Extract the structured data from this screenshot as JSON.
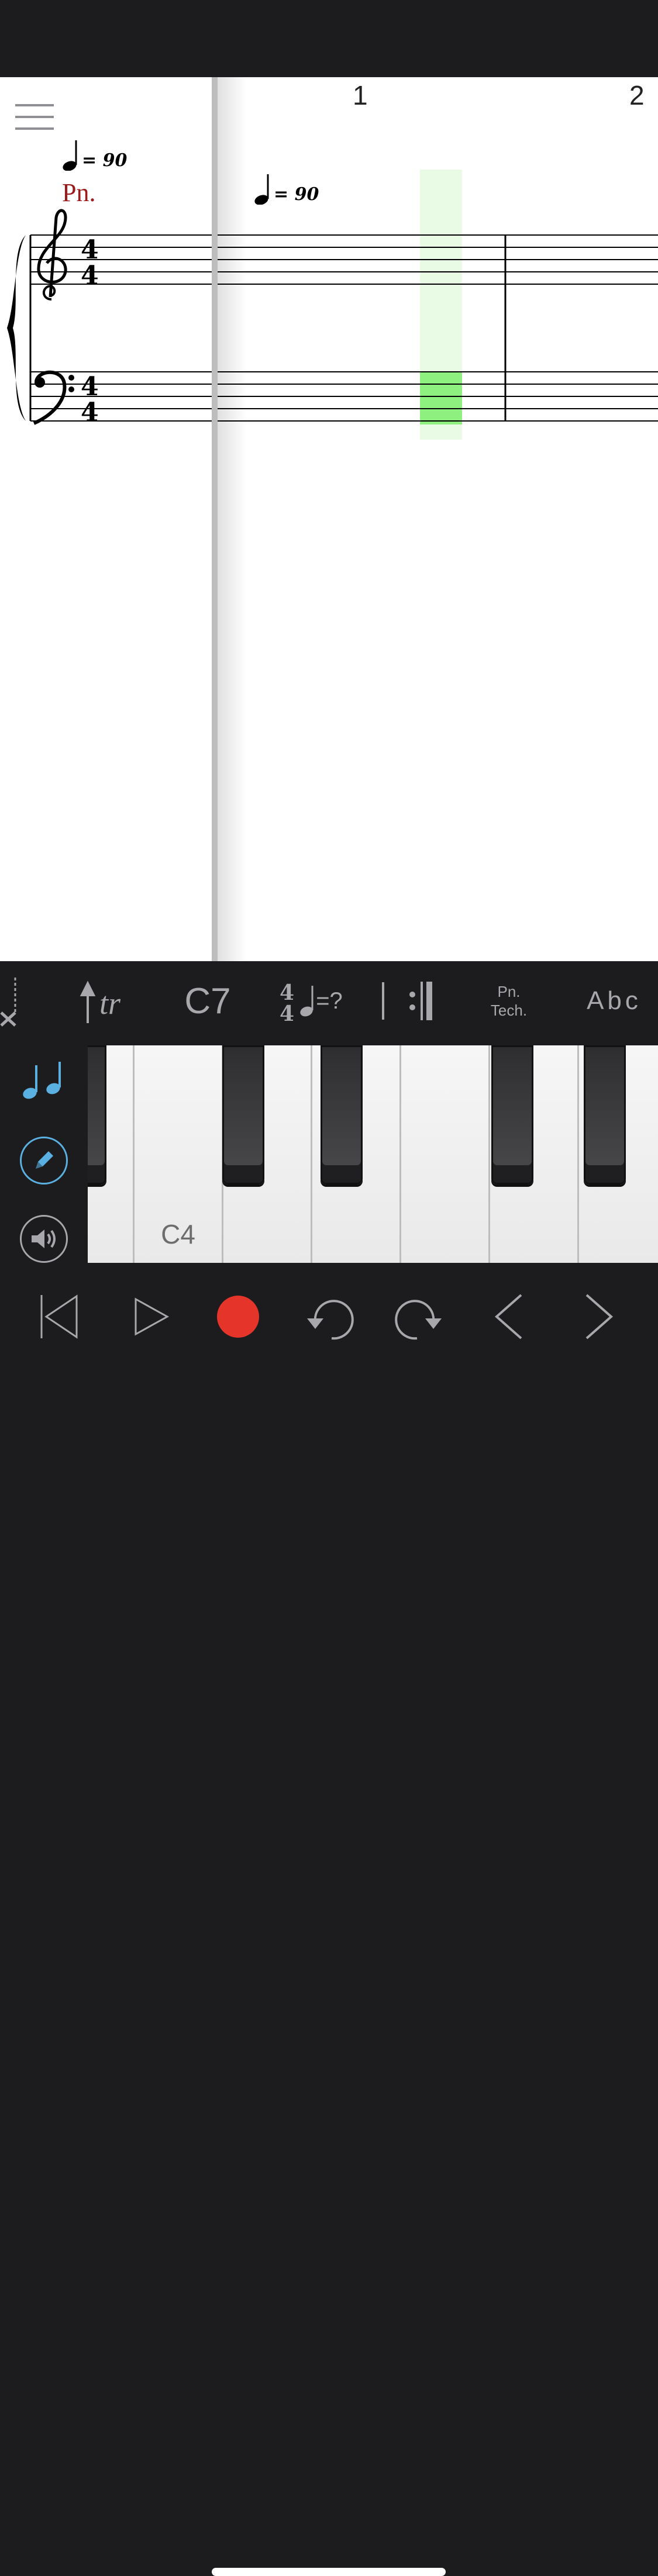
{
  "score": {
    "measure_numbers": [
      "1",
      "2"
    ],
    "tempo_marking": "= 90",
    "instrument_label": "Pn."
  },
  "toolbar": {
    "chord_label": "C7",
    "tempo_unknown": "=?",
    "technique_line1": "Pn.",
    "technique_line2": "Tech.",
    "text_label": "Abc"
  },
  "keyboard": {
    "c4_label": "C4"
  },
  "colors": {
    "accent_blue": "#5ab0e0",
    "record_red": "#e5352b",
    "instrument_red": "#9b1b1b",
    "highlight_green": "#8ef07e"
  }
}
